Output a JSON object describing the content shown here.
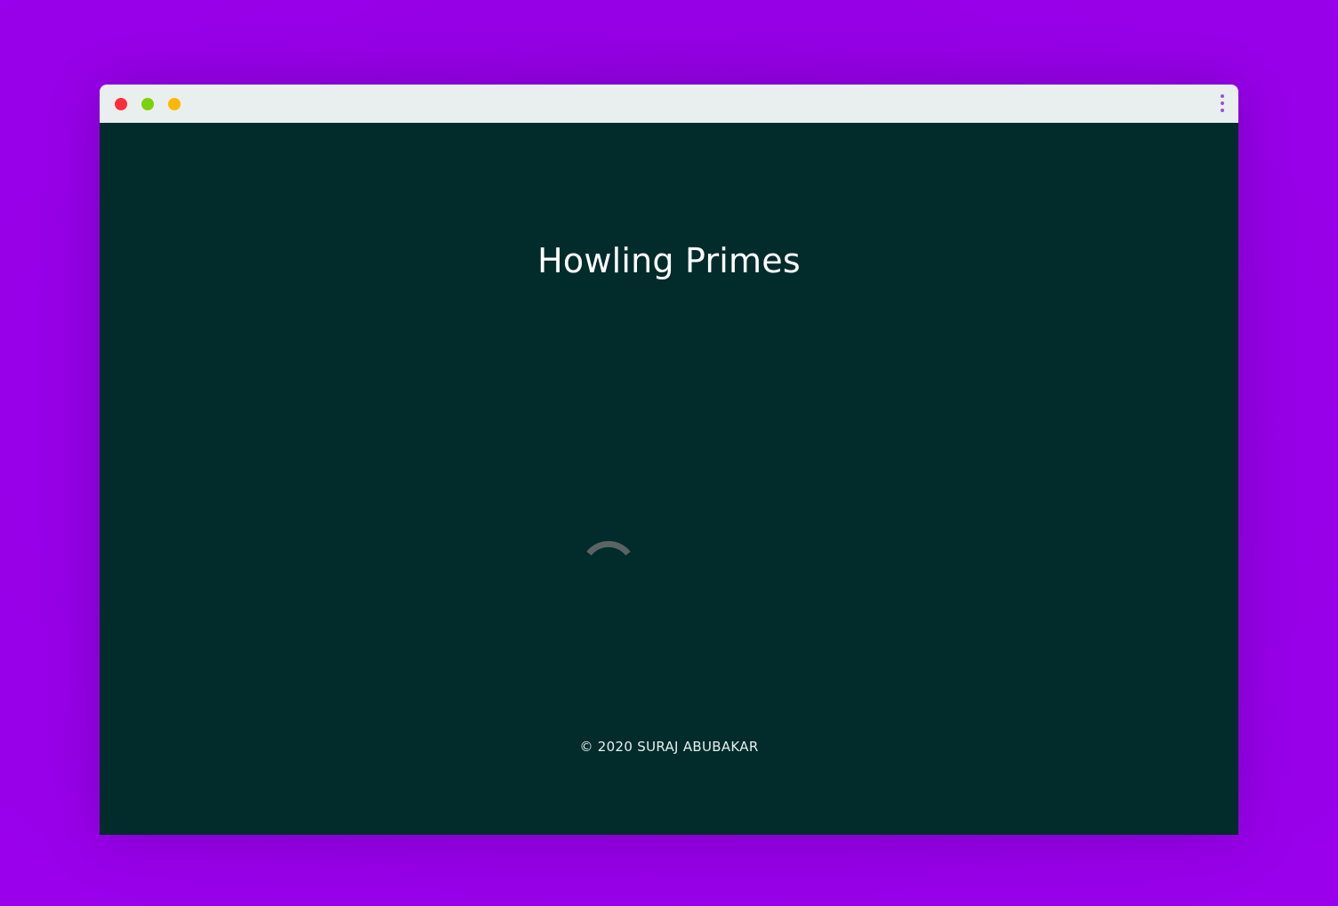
{
  "window": {
    "controls": [
      {
        "name": "close",
        "color": "#fe2f3a"
      },
      {
        "name": "minimize",
        "color": "#7bd208"
      },
      {
        "name": "maximize",
        "color": "#fcb800"
      }
    ],
    "menu_icon": "kebab-menu-icon",
    "menu_color": "#9b4ee0"
  },
  "page": {
    "title": "Howling Primes",
    "loading_icon": "loading-spinner-icon",
    "footer": "© 2020 SURAJ ABUBAKAR"
  },
  "colors": {
    "background": "#9a00ea",
    "titlebar": "#e9efef",
    "content": "#022b2b",
    "spinner": "#5a6464"
  }
}
